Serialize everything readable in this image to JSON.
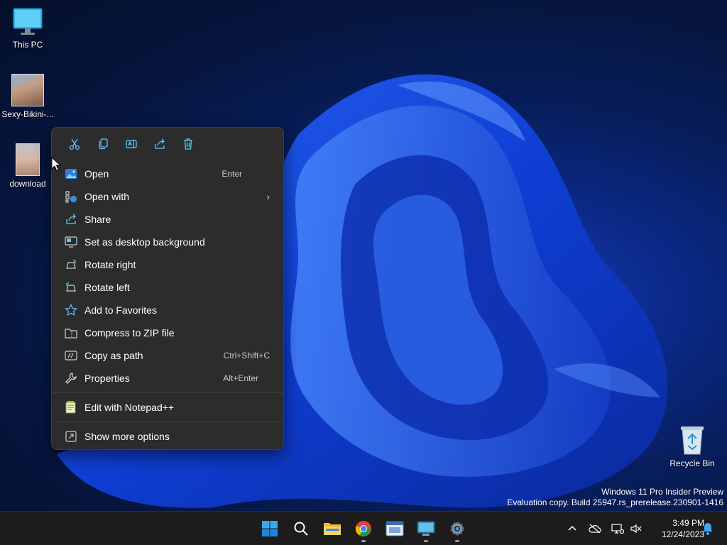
{
  "desktop": {
    "icons": [
      {
        "label": "This PC"
      },
      {
        "label": "Sexy-Bikini-..."
      },
      {
        "label": "download"
      },
      {
        "label": "Recycle Bin"
      }
    ]
  },
  "context_menu": {
    "toolbar": [
      {
        "icon": "cut-icon"
      },
      {
        "icon": "copy-icon"
      },
      {
        "icon": "rename-icon"
      },
      {
        "icon": "share-icon"
      },
      {
        "icon": "delete-icon"
      }
    ],
    "items": [
      {
        "label": "Open",
        "shortcut": "Enter",
        "icon": "open-image-icon"
      },
      {
        "label": "Open with",
        "shortcut": "",
        "icon": "open-with-icon",
        "submenu": true
      },
      {
        "label": "Share",
        "shortcut": "",
        "icon": "share-icon"
      },
      {
        "label": "Set as desktop background",
        "shortcut": "",
        "icon": "desktop-background-icon"
      },
      {
        "label": "Rotate right",
        "shortcut": "",
        "icon": "rotate-right-icon"
      },
      {
        "label": "Rotate left",
        "shortcut": "",
        "icon": "rotate-left-icon"
      },
      {
        "label": "Add to Favorites",
        "shortcut": "",
        "icon": "star-icon"
      },
      {
        "label": "Compress to ZIP file",
        "shortcut": "",
        "icon": "zip-folder-icon"
      },
      {
        "label": "Copy as path",
        "shortcut": "Ctrl+Shift+C",
        "icon": "copy-path-icon"
      },
      {
        "label": "Properties",
        "shortcut": "Alt+Enter",
        "icon": "wrench-icon"
      }
    ],
    "extra_items": [
      {
        "label": "Edit with Notepad++",
        "icon": "notepadpp-icon"
      }
    ],
    "footer_item": {
      "label": "Show more options",
      "icon": "show-more-icon"
    }
  },
  "watermark": {
    "line1": "Windows 11 Pro Insider Preview",
    "line2": "Evaluation copy. Build 25947.rs_prerelease.230901-1416"
  },
  "taskbar": {
    "apps": [
      {
        "name": "start-button",
        "running": false
      },
      {
        "name": "search-button",
        "running": false
      },
      {
        "name": "file-explorer-app",
        "running": false
      },
      {
        "name": "chrome-app",
        "running": true
      },
      {
        "name": "file-manager-app",
        "running": false
      },
      {
        "name": "remote-app",
        "running": true
      },
      {
        "name": "settings-app",
        "running": true
      }
    ],
    "clock": {
      "time": "3:49 PM",
      "date": "12/24/2023"
    }
  },
  "colors": {
    "menu_bg": "#2c2c2c",
    "taskbar_bg": "#1c1c1c",
    "accent": "#4cc2ff"
  }
}
